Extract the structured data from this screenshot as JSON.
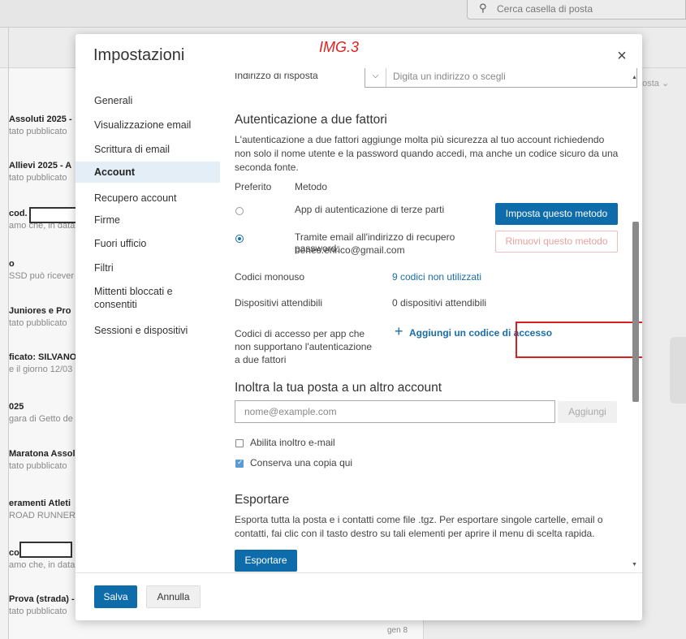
{
  "background": {
    "search_placeholder": "Cerca casella di posta",
    "right_label": "posta",
    "date": "gen 8",
    "list": [
      {
        "title": "Assoluti 2025 -",
        "sub": "tato pubblicato"
      },
      {
        "title": "Allievi 2025 - A",
        "sub": "tato pubblicato"
      },
      {
        "title": "cod.",
        "sub": "amo che, in data"
      },
      {
        "title": "o",
        "sub": "SSD può ricever"
      },
      {
        "title": "Juniores e Pro",
        "sub": "tato pubblicato"
      },
      {
        "title": "ficato: SILVANO",
        "sub": "e il giorno 12/03"
      },
      {
        "title": "025",
        "sub": "gara di Getto de"
      },
      {
        "title": "Maratona Assolu",
        "sub": "tato pubblicato"
      },
      {
        "title": "eramenti Atleti",
        "sub": "ROAD RUNNERS"
      },
      {
        "title": "co",
        "sub": "amo che, in data"
      },
      {
        "title": "Prova (strada) -",
        "sub": "tato pubblicato"
      }
    ]
  },
  "modal": {
    "title": "Impostazioni",
    "image_label": "IMG.3",
    "close": "×",
    "nav": [
      "Generali",
      "Visualizzazione email",
      "Scrittura di email",
      "Account",
      "Recupero account",
      "Firme",
      "Fuori ufficio",
      "Filtri",
      "Mittenti bloccati e consentiti",
      "Sessioni e dispositivi"
    ],
    "reply": {
      "label": "Indirizzo di risposta",
      "placeholder": "Digita un indirizzo o scegli"
    },
    "two_factor": {
      "heading": "Autenticazione a due fattori",
      "description": "L'autenticazione a due fattori aggiunge molta più sicurezza al tuo account richiedendo non solo il nome utente e la password quando accedi, ma anche un codice sicuro da una seconda fonte.",
      "col_preferred": "Preferito",
      "col_method": "Metodo",
      "method_app": "App di autenticazione di terze parti",
      "method_app_button": "Imposta questo metodo",
      "method_email_line1": "Tramite email all'indirizzo di recupero password:",
      "method_email_line2": "benes.enrico@gmail.com",
      "method_email_button": "Rimuovi questo metodo",
      "one_time_label": "Codici monouso",
      "one_time_value": "9 codici non utilizzati",
      "trusted_label": "Dispositivi attendibili",
      "trusted_value": "0 dispositivi attendibili",
      "app_codes_label_1": "Codici di accesso per app che",
      "app_codes_label_2": "non supportano l'autenticazione",
      "app_codes_label_3": "a due fattori",
      "add_code_plus": "+",
      "add_code": "Aggiungi un codice di accesso"
    },
    "forward": {
      "heading": "Inoltra la tua posta a un altro account",
      "placeholder": "nome@example.com",
      "add_button": "Aggiungi",
      "enable_label": "Abilita inoltro e-mail",
      "keep_copy_label": "Conserva una copia qui",
      "enable_checked": false,
      "keep_copy_checked": true
    },
    "export": {
      "heading": "Esportare",
      "description": "Esporta tutta la posta e i contatti come file .tgz. Per esportare singole cartelle, email o contatti, fai clic con il tasto destro su tali elementi per aprire il menu di scelta rapida.",
      "button": "Esportare"
    },
    "footer": {
      "save": "Salva",
      "cancel": "Annulla"
    }
  },
  "colors": {
    "accent": "#0f6cab",
    "link": "#1a6da8",
    "highlight_box": "#d82020"
  }
}
